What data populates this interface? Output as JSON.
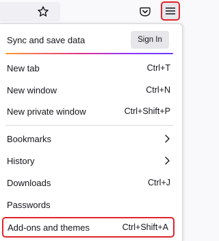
{
  "toolbar": {
    "bookmark_icon": "star-icon",
    "pocket_icon": "pocket-icon",
    "menu_icon": "hamburger-menu-icon"
  },
  "sync": {
    "label": "Sync and save data",
    "button_label": "Sign In"
  },
  "menu": {
    "new_tab": {
      "label": "New tab",
      "shortcut": "Ctrl+T"
    },
    "new_window": {
      "label": "New window",
      "shortcut": "Ctrl+N"
    },
    "new_private_window": {
      "label": "New private window",
      "shortcut": "Ctrl+Shift+P"
    },
    "bookmarks": {
      "label": "Bookmarks"
    },
    "history": {
      "label": "History"
    },
    "downloads": {
      "label": "Downloads",
      "shortcut": "Ctrl+J"
    },
    "passwords": {
      "label": "Passwords"
    },
    "addons": {
      "label": "Add-ons and themes",
      "shortcut": "Ctrl+Shift+A"
    }
  },
  "colors": {
    "highlight": "#e0242b",
    "gradient_start": "#ff9b2e",
    "gradient_mid": "#e0318b",
    "gradient_end": "#6a3cff"
  }
}
